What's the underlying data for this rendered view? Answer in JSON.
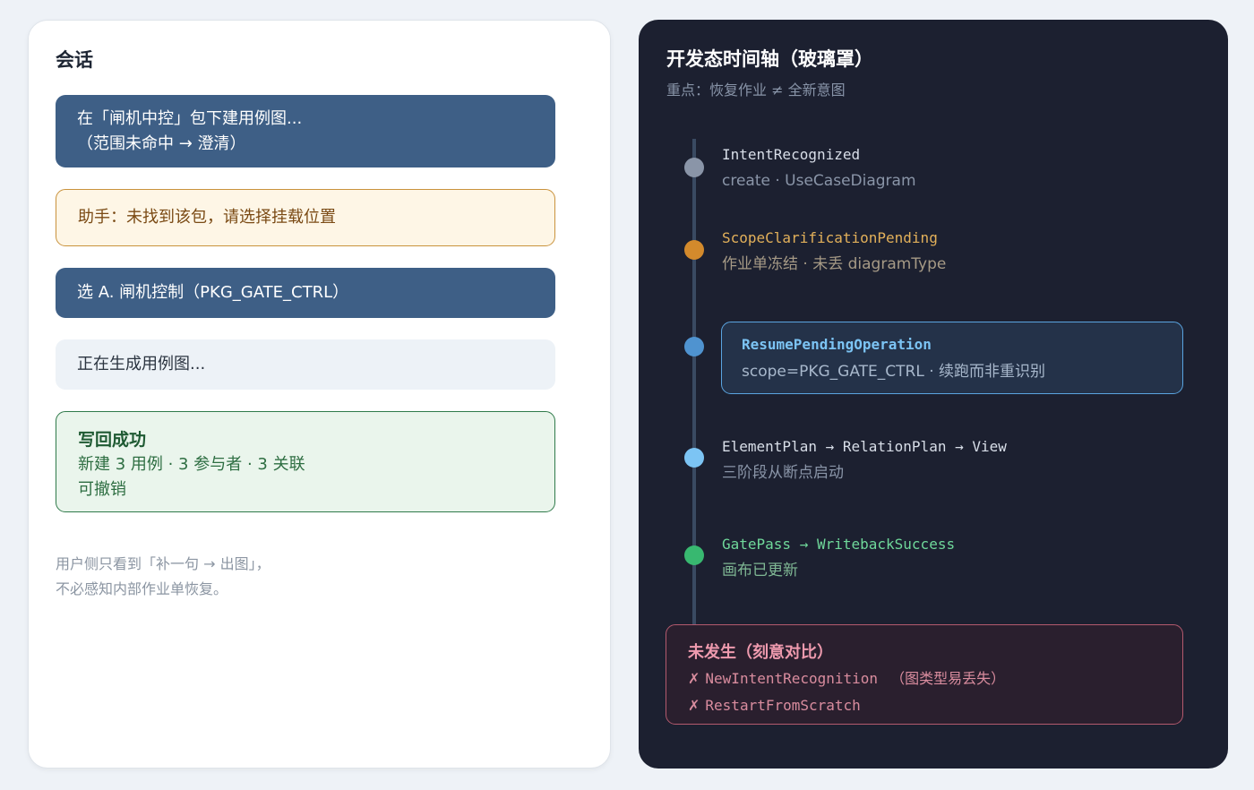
{
  "conversation": {
    "title": "会话",
    "user_msg_1": {
      "line1": "在「闸机中控」包下建用例图...",
      "line2": "（范围未命中 → 澄清）"
    },
    "assistant_msg": "助手：未找到该包，请选择挂载位置",
    "user_msg_2": "选 A. 闸机控制（PKG_GATE_CTRL）",
    "generating_msg": "正在生成用例图...",
    "success": {
      "title": "写回成功",
      "detail": "新建 3 用例 · 3 参与者 · 3 关联",
      "undo": "可撤销"
    },
    "footnote": {
      "line1": "用户侧只看到「补一句 → 出图」，",
      "line2": "不必感知内部作业单恢复。"
    }
  },
  "timeline": {
    "title": "开发态时间轴（玻璃罩）",
    "subtitle": "重点：恢复作业 ≠ 全新意图",
    "events": [
      {
        "name": "IntentRecognized",
        "desc": "create · UseCaseDiagram",
        "color": "#8a95a8",
        "desc_color": "#8a95a8"
      },
      {
        "name": "ScopeClarificationPending",
        "desc": "作业单冻结 · 未丢 diagramType",
        "color": "#e2b05a",
        "desc_color": "#a69a86",
        "dot": "#d38a2c"
      },
      {
        "name": "ResumePendingOperation",
        "desc": "scope=PKG_GATE_CTRL · 续跑而非重识别",
        "color": "#7cc4f4",
        "dot": "#4f93d0"
      },
      {
        "name": "ElementPlan → RelationPlan → View",
        "desc": "三阶段从断点启动",
        "color": "#d8dee8",
        "desc_color": "#8a95a8",
        "dot": "#7cc4f4"
      },
      {
        "name": "GatePass → WritebackSuccess",
        "desc": "画布已更新",
        "color": "#6fd89a",
        "desc_color": "#7fb894",
        "dot": "#38b870"
      }
    ],
    "not_happened": {
      "title": "未发生（刻意对比）",
      "items": [
        {
          "mark": "✗",
          "name": "NewIntentRecognition",
          "note": "（图类型易丢失）"
        },
        {
          "mark": "✗",
          "name": "RestartFromScratch",
          "note": ""
        }
      ]
    }
  }
}
